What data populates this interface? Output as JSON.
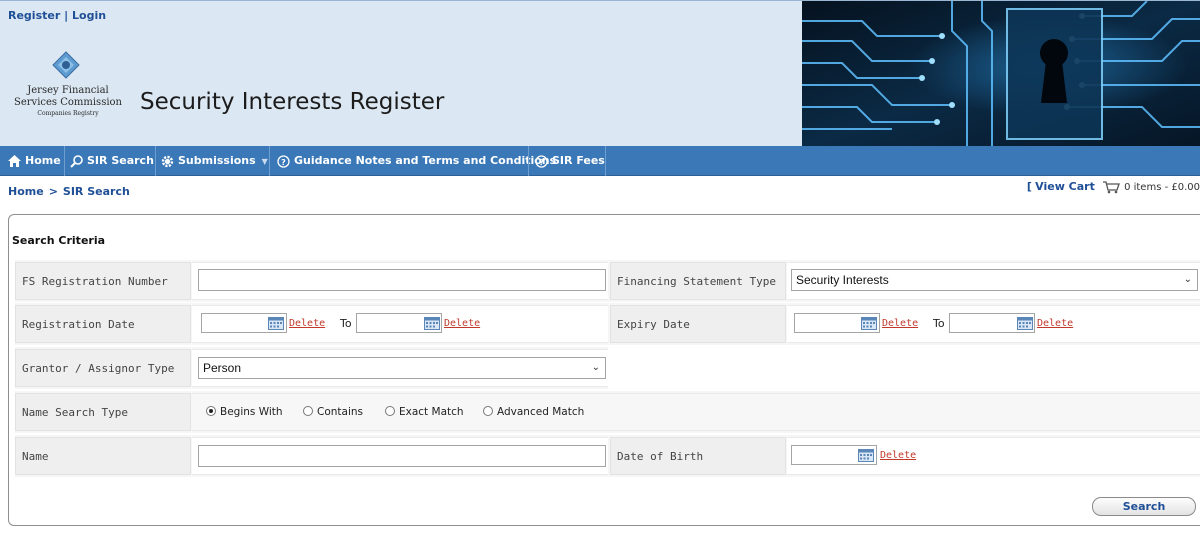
{
  "header": {
    "register_label": "Register",
    "auth_separator": "|",
    "login_label": "Login",
    "logo_line1": "Jersey Financial",
    "logo_line2": "Services Commission",
    "logo_line3": "Companies Registry",
    "title": "Security Interests Register"
  },
  "nav": {
    "items": [
      {
        "label": "Home",
        "icon": "home-icon"
      },
      {
        "label": "SIR Search",
        "icon": "search-icon"
      },
      {
        "label": "Submissions",
        "icon": "gear-icon"
      },
      {
        "label": "Guidance Notes and Terms and Conditions",
        "icon": "help-icon"
      },
      {
        "label": "SIR Fees",
        "icon": "help-icon"
      }
    ]
  },
  "breadcrumb": {
    "items": [
      "Home",
      "SIR Search"
    ],
    "separator": ">"
  },
  "cart": {
    "open_bracket": "[",
    "view_label": "View Cart",
    "summary": "0 items - £0.00"
  },
  "form": {
    "title": "Search Criteria",
    "fs_registration_number": {
      "label": "FS Registration Number",
      "value": ""
    },
    "financing_statement_type": {
      "label": "Financing Statement Type",
      "value": "Security Interests"
    },
    "registration_date": {
      "label": "Registration Date",
      "from": "",
      "to": "",
      "to_label": "To",
      "delete_label": "Delete"
    },
    "expiry_date": {
      "label": "Expiry Date",
      "from": "",
      "to": "",
      "to_label": "To",
      "delete_label": "Delete"
    },
    "grantor_type": {
      "label": "Grantor / Assignor Type",
      "value": "Person"
    },
    "name_search_type": {
      "label": "Name Search Type",
      "options": [
        "Begins With",
        "Contains",
        "Exact Match",
        "Advanced Match"
      ],
      "selected": "Begins With"
    },
    "name": {
      "label": "Name",
      "value": ""
    },
    "date_of_birth": {
      "label": "Date of Birth",
      "value": "",
      "delete_label": "Delete"
    },
    "search_label": "Search"
  },
  "colors": {
    "nav_bg": "#3a78b8",
    "header_bg": "#dbe7f2",
    "link": "#1f4f96",
    "delete_link": "#c0392b"
  }
}
